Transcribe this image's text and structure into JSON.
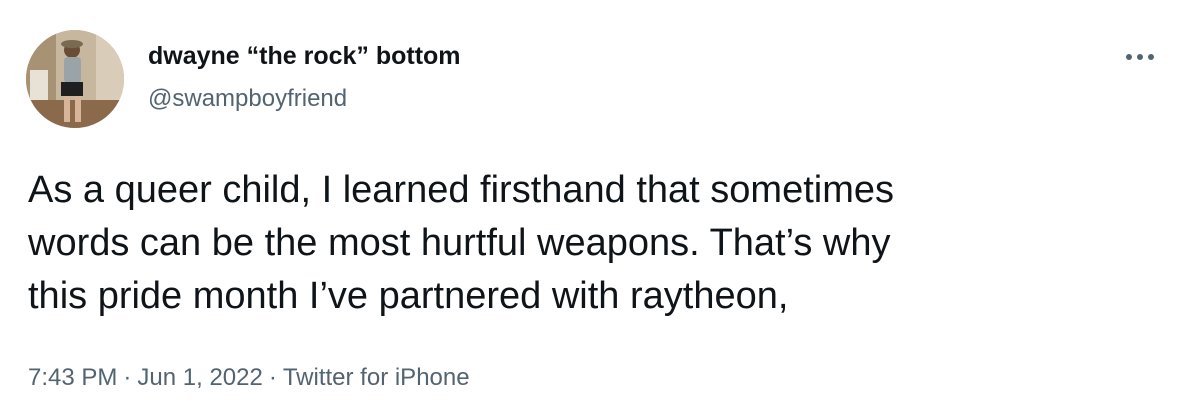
{
  "tweet": {
    "author": {
      "display_name": "dwayne “the rock” bottom",
      "handle": "@swampboyfriend",
      "avatar_icon": "user-avatar-photo"
    },
    "more_icon": "more-horizontal-icon",
    "text_lines": [
      "As a queer child, I learned firsthand that sometimes",
      "words can be the most hurtful weapons. That’s why",
      "this pride month I’ve partnered with raytheon,"
    ],
    "meta": {
      "time": "7:43 PM",
      "date": "Jun 1, 2022",
      "separator": "·",
      "source": "Twitter for iPhone"
    }
  },
  "colors": {
    "text_primary": "#0f1419",
    "text_secondary": "#536471",
    "background": "#ffffff"
  }
}
